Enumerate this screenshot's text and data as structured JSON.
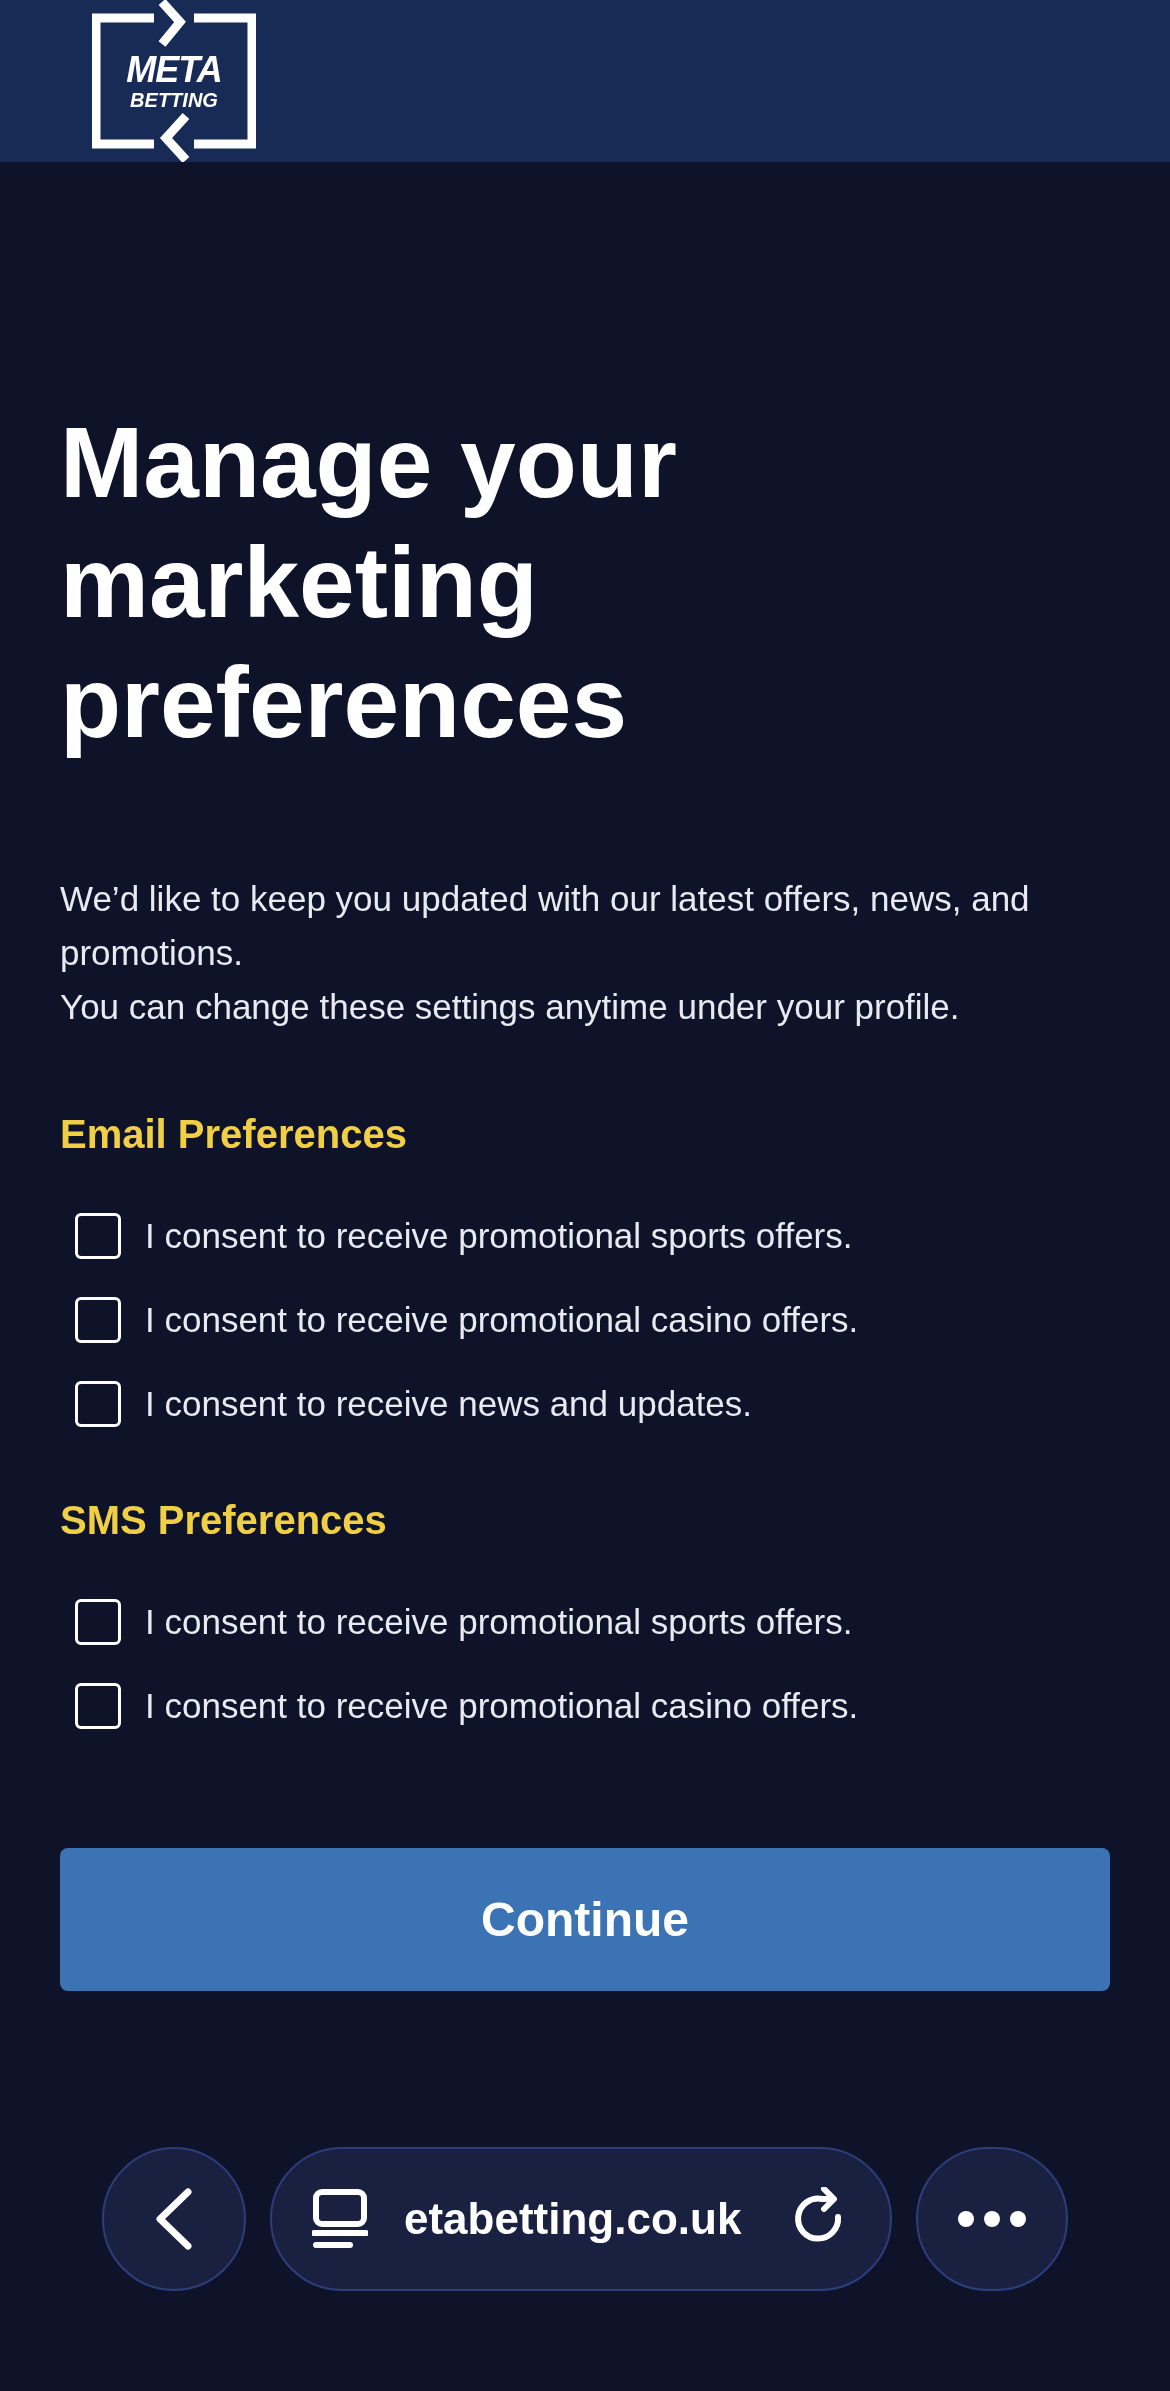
{
  "header": {
    "logo": {
      "line_1": "META",
      "line_2": "BETTING"
    }
  },
  "title": "Manage your marketing preferences",
  "intro": [
    "We’d like to keep you updated with our latest offers, news, and promotions.",
    "You can change these settings anytime under your profile."
  ],
  "sections": [
    {
      "heading": "Email Preferences",
      "options": [
        {
          "label": "I consent to receive promotional sports offers.",
          "checked": false
        },
        {
          "label": "I consent to receive promotional casino offers.",
          "checked": false
        },
        {
          "label": "I consent to receive news and updates.",
          "checked": false
        }
      ]
    },
    {
      "heading": "SMS Preferences",
      "options": [
        {
          "label": "I consent to receive promotional sports offers.",
          "checked": false
        },
        {
          "label": "I consent to receive promotional casino offers.",
          "checked": false
        }
      ]
    }
  ],
  "continue_button": "Continue",
  "browser_bar": {
    "url": "etabetting.co.uk"
  }
}
